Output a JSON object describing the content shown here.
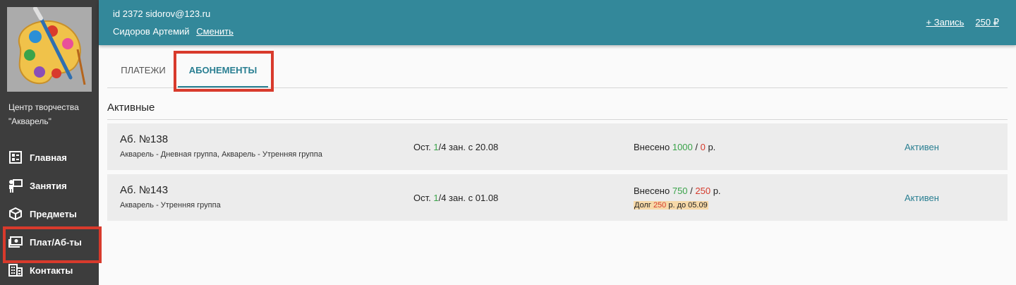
{
  "org": {
    "name": "Центр творчества \"Акварель\""
  },
  "nav": {
    "items": [
      {
        "label": "Главная",
        "icon": "dashboard-icon"
      },
      {
        "label": "Занятия",
        "icon": "teacher-icon"
      },
      {
        "label": "Предметы",
        "icon": "cube-icon"
      },
      {
        "label": "Плат/Аб-ты",
        "icon": "money-icon",
        "active": true
      },
      {
        "label": "Контакты",
        "icon": "building-icon"
      }
    ]
  },
  "header": {
    "user_id": "id 2372 sidorov@123.ru",
    "user_name": "Сидоров Артемий",
    "change_link": "Сменить",
    "add_record": "+ Запись",
    "balance": "250 ₽"
  },
  "tabs": {
    "payments": "ПЛАТЕЖИ",
    "subscriptions": "АБОНЕМЕНТЫ"
  },
  "section": {
    "title": "Активные"
  },
  "subscriptions": [
    {
      "number": "Аб. №138",
      "groups": "Акварель - Дневная группа, Акварель - Утренняя группа",
      "ost_prefix": "Ост. ",
      "ost_used": "1",
      "ost_suffix": "/4 зан. с 20.08",
      "paid_prefix": "Внесено ",
      "paid": "1000",
      "sep": " / ",
      "owed": "0",
      "paid_suffix": " р.",
      "debt_prefix": "",
      "debt_amount": "",
      "debt_suffix": "",
      "status": "Активен"
    },
    {
      "number": "Аб. №143",
      "groups": "Акварель - Утренняя группа",
      "ost_prefix": "Ост. ",
      "ost_used": "1",
      "ost_suffix": "/4 зан. с 01.08",
      "paid_prefix": "Внесено ",
      "paid": "750",
      "sep": " / ",
      "owed": "250",
      "paid_suffix": " р.",
      "debt_prefix": "Долг ",
      "debt_amount": "250",
      "debt_suffix": " р. до 05.09",
      "status": "Активен"
    }
  ],
  "colors": {
    "accent": "#33889a",
    "sidebar": "#3d3d3d",
    "highlight": "#d83a2c",
    "green": "#3aa34a",
    "red": "#d53a2c"
  }
}
